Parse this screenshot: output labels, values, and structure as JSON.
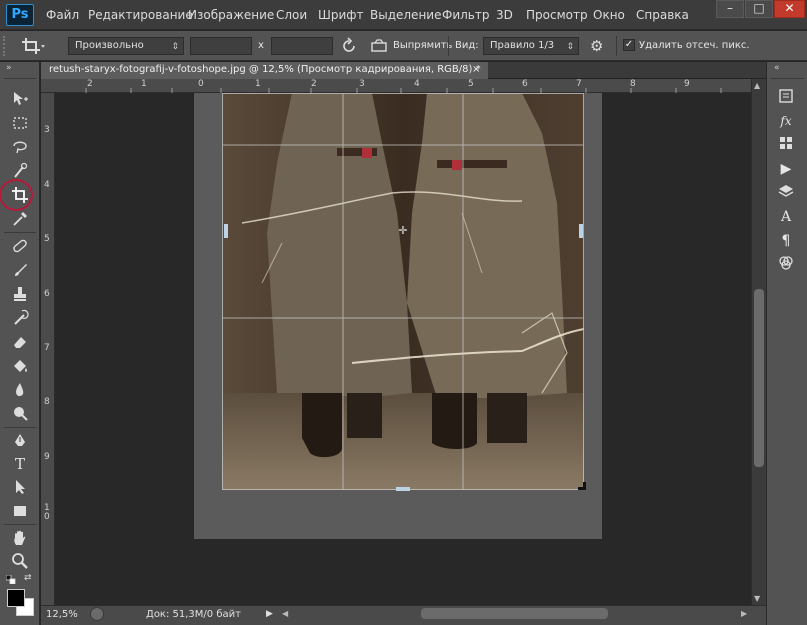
{
  "app": {
    "logo": "Ps",
    "menu": [
      "Файл",
      "Редактирование",
      "Изображение",
      "Слои",
      "Шрифт",
      "Выделение",
      "Фильтр",
      "3D",
      "Просмотр",
      "Окно",
      "Справка"
    ],
    "window_buttons": {
      "minimize": "–",
      "restore": "□",
      "close": "✕"
    }
  },
  "options": {
    "ratio_value": "Произвольно",
    "swap_symbol": "x",
    "straighten_label": "Выпрямить",
    "view_label": "Вид:",
    "view_value": "Правило 1/3",
    "delete_cropped_label": "Удалить отсеч. пикс.",
    "delete_cropped_checked": true
  },
  "document": {
    "tab_title": "retush-staryx-fotografij-v-fotoshope.jpg @ 12,5% (Просмотр кадрирования, RGB/8) *",
    "tab_close": "×"
  },
  "rulers": {
    "top_ticks": [
      "2",
      "1",
      "0",
      "1",
      "2",
      "3",
      "4",
      "5",
      "6",
      "7",
      "8",
      "9"
    ],
    "left_ticks": [
      "3",
      "4",
      "5",
      "6",
      "7",
      "8",
      "9",
      "1\n0"
    ]
  },
  "status": {
    "zoom": "12,5%",
    "doc_info": "Док: 51,3M/0 байт"
  },
  "toolbar": {
    "collapse": "»",
    "tools": [
      "move-tool",
      "marquee-tool",
      "lasso-tool",
      "quick-select-tool",
      "crop-tool",
      "eyedropper-tool",
      "healing-tool",
      "brush-tool",
      "stamp-tool",
      "history-brush-tool",
      "eraser-tool",
      "fill-tool",
      "blur-tool",
      "dodge-tool",
      "pen-tool",
      "text-tool",
      "path-select-tool",
      "shape-tool",
      "hand-tool",
      "zoom-tool"
    ],
    "active_tool": "crop-tool",
    "foreground_color": "#000000",
    "background_color": "#ffffff"
  },
  "colors": {
    "highlight": "#b61a3a",
    "ps_blue": "#31a8ff"
  }
}
